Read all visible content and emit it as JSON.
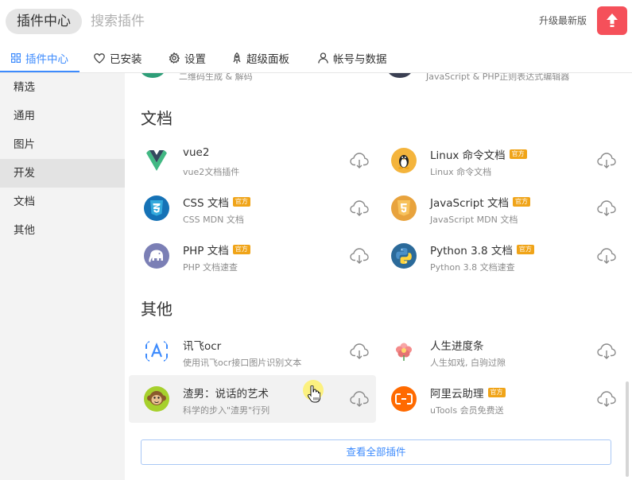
{
  "header": {
    "title": "插件中心",
    "search_placeholder": "搜索插件",
    "upgrade_label": "升级最新版"
  },
  "tabs": [
    {
      "label": "插件中心",
      "icon": "grid-icon",
      "active": true
    },
    {
      "label": "已安装",
      "icon": "heart-icon",
      "active": false
    },
    {
      "label": "设置",
      "icon": "gear-icon",
      "active": false
    },
    {
      "label": "超级面板",
      "icon": "rocket-icon",
      "active": false
    },
    {
      "label": "帐号与数据",
      "icon": "user-icon",
      "active": false
    }
  ],
  "sidebar": {
    "items": [
      {
        "label": "精选",
        "active": false
      },
      {
        "label": "通用",
        "active": false
      },
      {
        "label": "图片",
        "active": false
      },
      {
        "label": "开发",
        "active": true
      },
      {
        "label": "文档",
        "active": false
      },
      {
        "label": "其他",
        "active": false
      }
    ]
  },
  "partial_row": {
    "left_desc": "二维码生成 & 解码",
    "right_desc": "JavaScript & PHP正则表达式编辑器"
  },
  "sections": [
    {
      "title": "文档",
      "plugins": [
        {
          "name": "vue2",
          "desc": "vue2文档插件",
          "official": false,
          "icon": "vue-logo-icon",
          "color": "#41b883"
        },
        {
          "name": "Linux 命令文档",
          "desc": "Linux 命令文档",
          "official": true,
          "icon": "tux-penguin-icon",
          "color": "#f4b43c"
        },
        {
          "name": "CSS 文档",
          "desc": "CSS MDN 文档",
          "official": true,
          "icon": "css3-icon",
          "color": "#1572b6"
        },
        {
          "name": "JavaScript 文档",
          "desc": "JavaScript MDN 文档",
          "official": true,
          "icon": "js-shield-icon",
          "color": "#e8a33d"
        },
        {
          "name": "PHP 文档",
          "desc": "PHP 文档速查",
          "official": true,
          "icon": "elephant-icon",
          "color": "#7b7fb5"
        },
        {
          "name": "Python 3.8 文档",
          "desc": "Python 3.8 文档速查",
          "official": true,
          "icon": "python-logo-icon",
          "color": "#2b6a9a"
        }
      ]
    },
    {
      "title": "其他",
      "plugins": [
        {
          "name": "讯飞ocr",
          "desc": "使用讯飞ocr接口图片识别文本",
          "official": false,
          "icon": "ocr-scan-icon",
          "color": "#3d8bfd"
        },
        {
          "name": "人生进度条",
          "desc": "人生如戏, 白驹过隙",
          "official": false,
          "icon": "flower-icon",
          "color": "#e57373"
        },
        {
          "name": "渣男：说话的艺术",
          "desc": "科学的步入\"渣男\"行列",
          "official": false,
          "icon": "monkey-icon",
          "color": "#a6d02c"
        },
        {
          "name": "阿里云助理",
          "desc": "uTools 会员免费送",
          "official": true,
          "icon": "aliyun-icon",
          "color": "#ff6a00"
        }
      ]
    }
  ],
  "official_badge": "官方",
  "view_all_label": "查看全部插件",
  "colors": {
    "accent": "#3d8bfd",
    "upgrade_button": "#f5505a",
    "badge": "#f0a418"
  }
}
